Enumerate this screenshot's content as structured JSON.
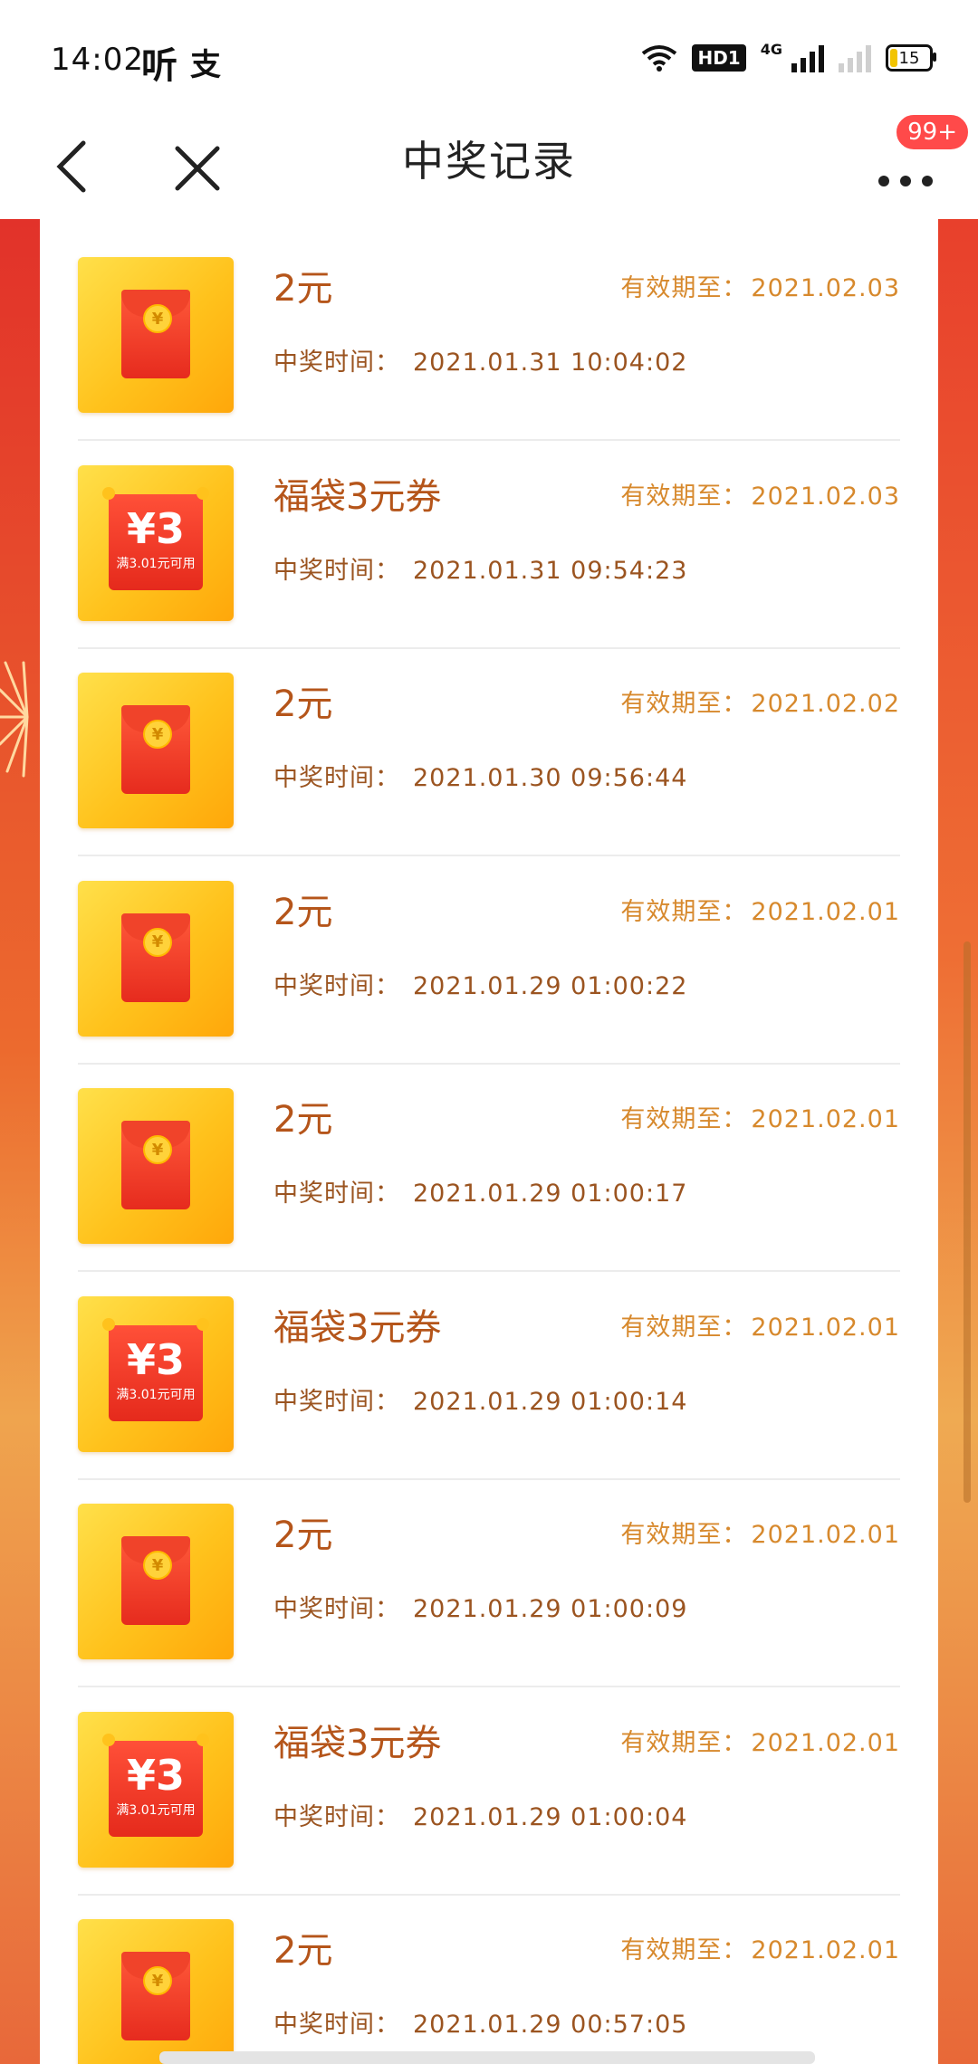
{
  "status_bar": {
    "time": "14:02",
    "app1": "听",
    "app2": "支",
    "hd": "HD1",
    "net": "4G",
    "battery": "15"
  },
  "navbar": {
    "title": "中奖记录",
    "badge": "99+"
  },
  "labels": {
    "expiry_prefix": "有效期至：",
    "time_prefix": "中奖时间："
  },
  "items": [
    {
      "type": "red-envelope",
      "title": "2元",
      "expiry": "2021.02.03",
      "time": "2021.01.31 10:04:02"
    },
    {
      "type": "coupon",
      "title": "福袋3元券",
      "expiry": "2021.02.03",
      "time": "2021.01.31 09:54:23",
      "coupon_amount": "¥3",
      "coupon_note": "满3.01元可用"
    },
    {
      "type": "red-envelope",
      "title": "2元",
      "expiry": "2021.02.02",
      "time": "2021.01.30 09:56:44"
    },
    {
      "type": "red-envelope",
      "title": "2元",
      "expiry": "2021.02.01",
      "time": "2021.01.29 01:00:22"
    },
    {
      "type": "red-envelope",
      "title": "2元",
      "expiry": "2021.02.01",
      "time": "2021.01.29 01:00:17"
    },
    {
      "type": "coupon",
      "title": "福袋3元券",
      "expiry": "2021.02.01",
      "time": "2021.01.29 01:00:14",
      "coupon_amount": "¥3",
      "coupon_note": "满3.01元可用"
    },
    {
      "type": "red-envelope",
      "title": "2元",
      "expiry": "2021.02.01",
      "time": "2021.01.29 01:00:09"
    },
    {
      "type": "coupon",
      "title": "福袋3元券",
      "expiry": "2021.02.01",
      "time": "2021.01.29 01:00:04",
      "coupon_amount": "¥3",
      "coupon_note": "满3.01元可用"
    },
    {
      "type": "red-envelope",
      "title": "2元",
      "expiry": "2021.02.01",
      "time": "2021.01.29 00:57:05"
    }
  ],
  "colors": {
    "title": "#b5551a",
    "expiry": "#d7892d",
    "time": "#9b5420",
    "badge": "#ff4a4a"
  }
}
